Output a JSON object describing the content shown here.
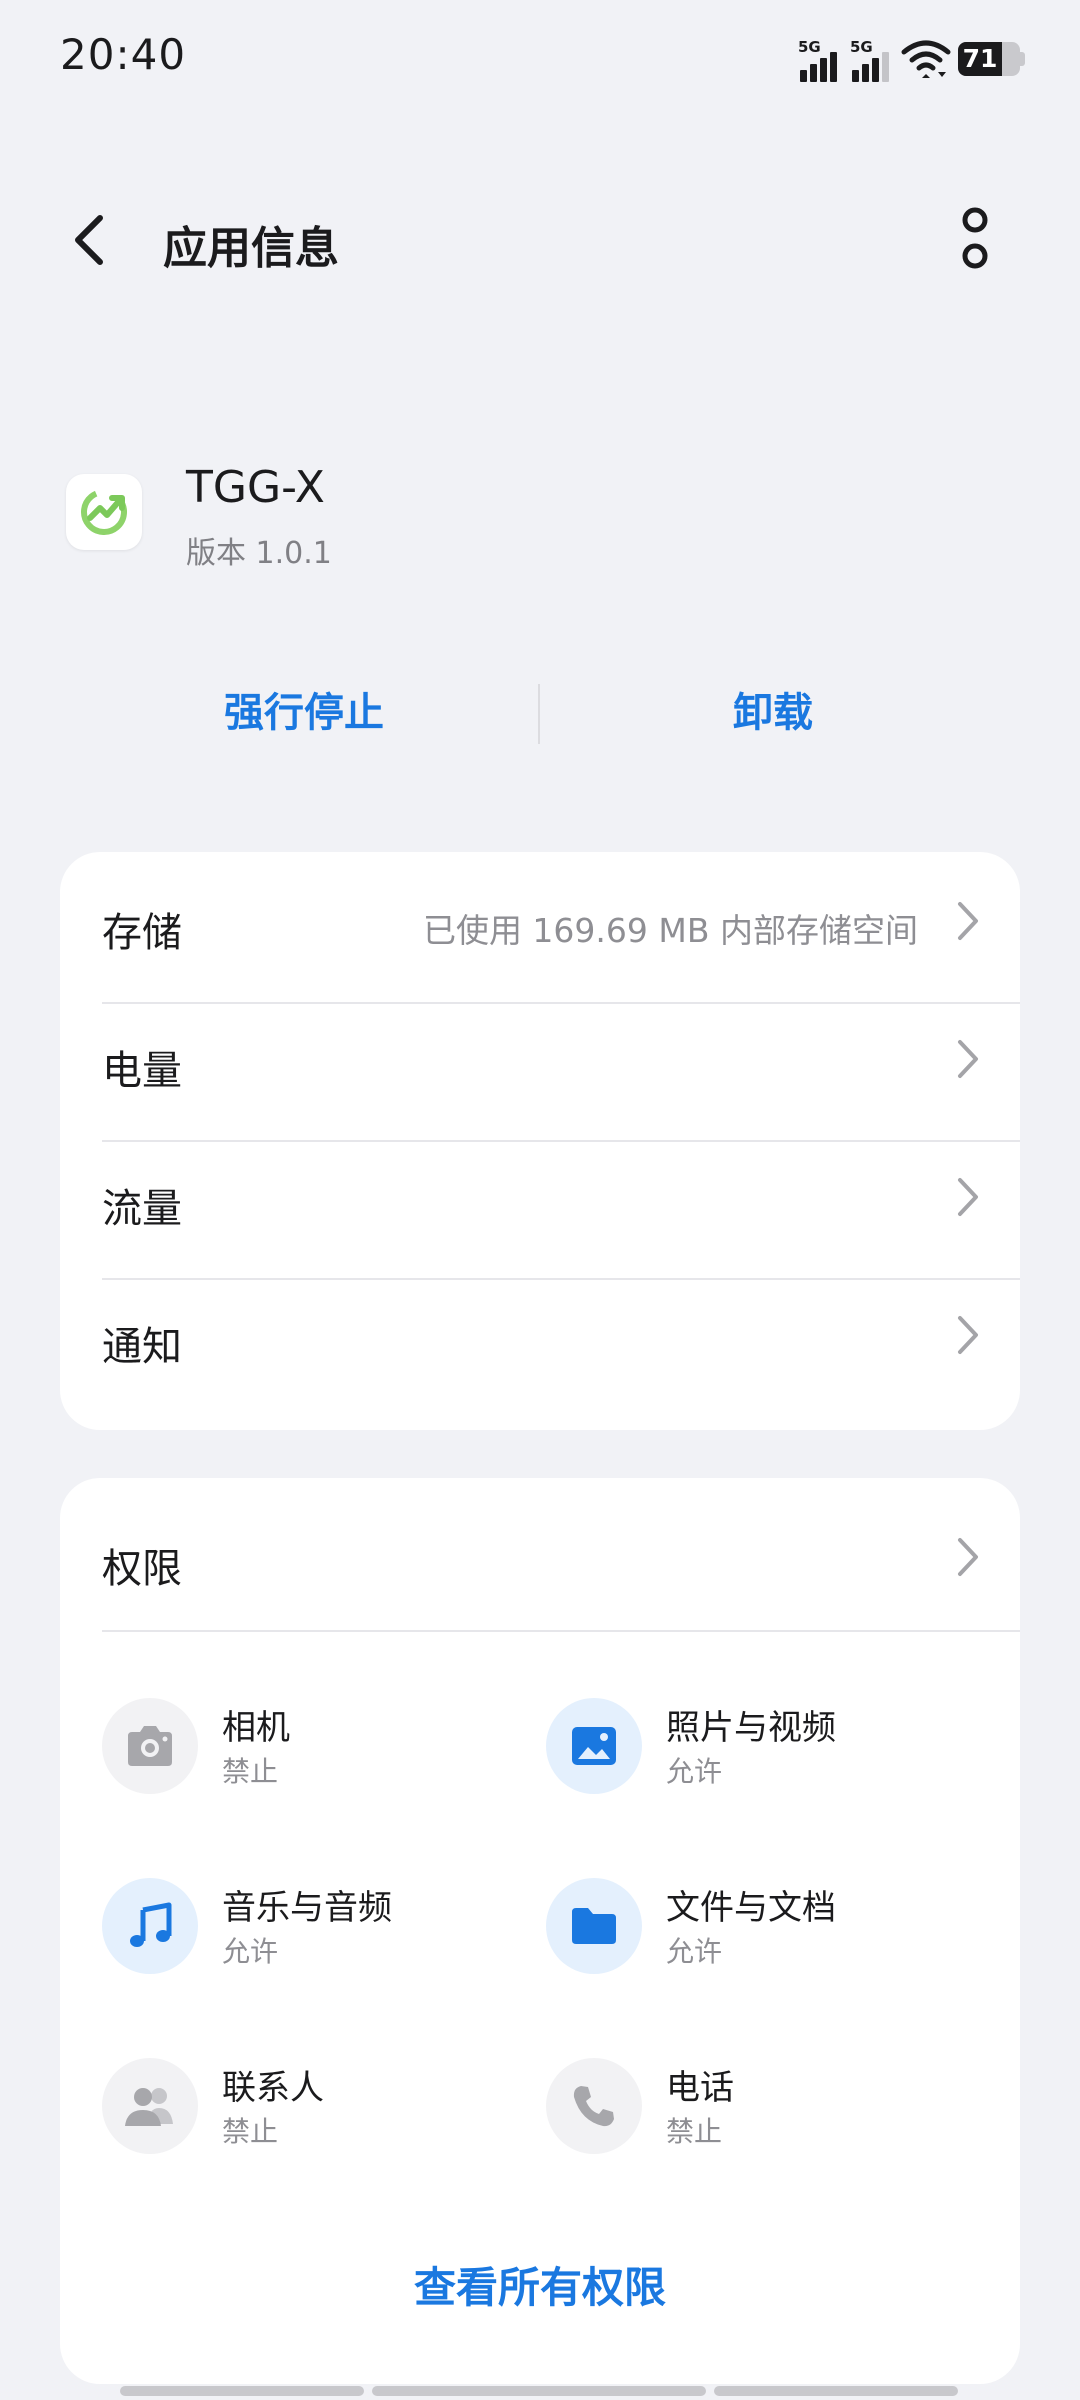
{
  "status_bar": {
    "time": "20:40",
    "network_1": "5G",
    "network_2": "5G",
    "battery": "71"
  },
  "header": {
    "title": "应用信息",
    "back_icon": "chevron-left-icon",
    "more_icon": "more-vertical-icon"
  },
  "app": {
    "name": "TGG-X",
    "version": "版本 1.0.1",
    "icon": "growth-arrow-icon"
  },
  "actions": {
    "force_stop": "强行停止",
    "uninstall": "卸载",
    "accent_color": "#1a78e0"
  },
  "settings": [
    {
      "label": "存储",
      "value": "已使用 169.69 MB 内部存储空间"
    },
    {
      "label": "电量",
      "value": ""
    },
    {
      "label": "流量",
      "value": ""
    },
    {
      "label": "通知",
      "value": ""
    }
  ],
  "permissions": {
    "title": "权限",
    "items": [
      {
        "name": "相机",
        "state": "禁止",
        "icon": "camera-icon"
      },
      {
        "name": "照片与视频",
        "state": "允许",
        "icon": "image-icon"
      },
      {
        "name": "音乐与音频",
        "state": "允许",
        "icon": "music-icon"
      },
      {
        "name": "文件与文档",
        "state": "允许",
        "icon": "folder-icon"
      },
      {
        "name": "联系人",
        "state": "禁止",
        "icon": "contacts-icon"
      },
      {
        "name": "电话",
        "state": "禁止",
        "icon": "phone-icon"
      }
    ],
    "view_all": "查看所有权限"
  }
}
